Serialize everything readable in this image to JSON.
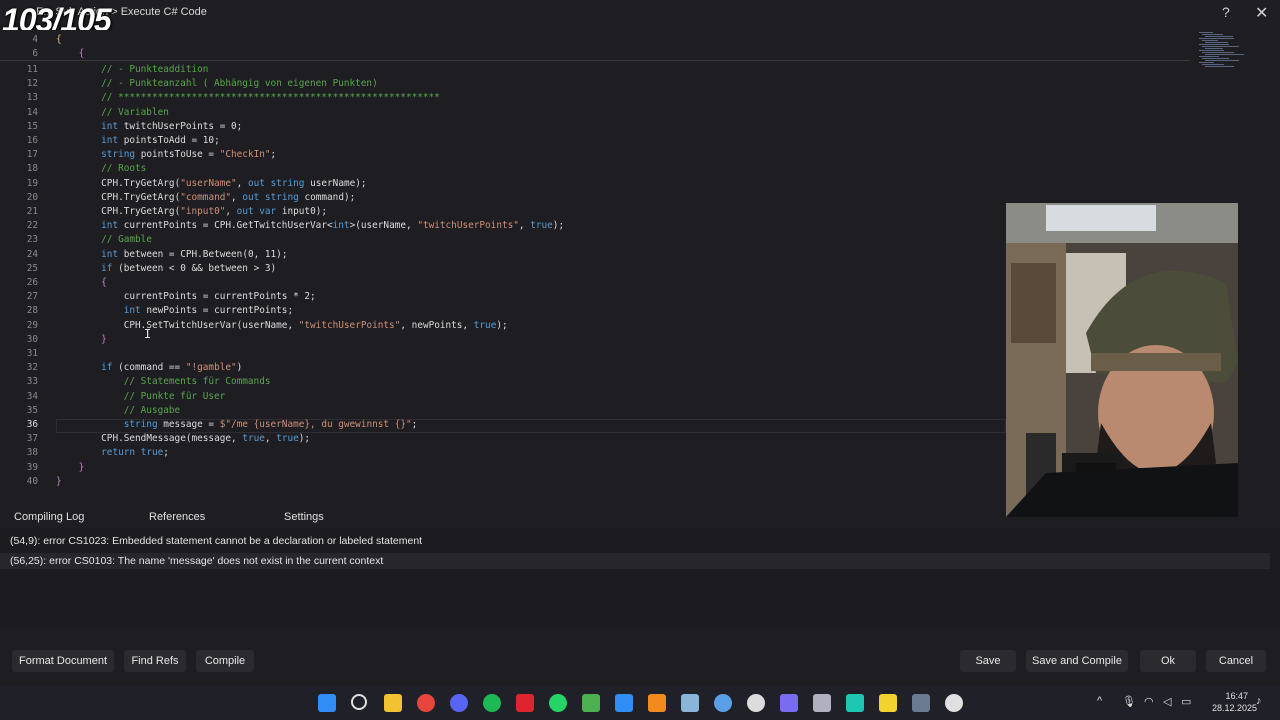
{
  "window": {
    "title": "E... Sub Action > Execute C# Code",
    "overlay_counter": "103/105",
    "help_glyph": "?",
    "close_glyph": "✕"
  },
  "editor": {
    "folded": [
      {
        "num": "4",
        "text": "{"
      },
      {
        "num": "6",
        "text": "    {"
      }
    ],
    "lines": [
      {
        "num": "11",
        "code": "        // - Punkteaddition"
      },
      {
        "num": "12",
        "code": "        // - Punkteanzahl ( Abhängig von eigenen Punkten)"
      },
      {
        "num": "13",
        "code": "        // *********************************************************"
      },
      {
        "num": "14",
        "code": "        // Variablen"
      },
      {
        "num": "15",
        "code": "        int twitchUserPoints = 0;"
      },
      {
        "num": "16",
        "code": "        int pointsToAdd = 10;"
      },
      {
        "num": "17",
        "code": "        string pointsToUse = \"CheckIn\";"
      },
      {
        "num": "18",
        "code": "        // Roots"
      },
      {
        "num": "19",
        "code": "        CPH.TryGetArg(\"userName\", out string userName);"
      },
      {
        "num": "20",
        "code": "        CPH.TryGetArg(\"command\", out string command);"
      },
      {
        "num": "21",
        "code": "        CPH.TryGetArg(\"input0\", out var input0);"
      },
      {
        "num": "22",
        "code": "        int currentPoints = CPH.GetTwitchUserVar<int>(userName, \"twitchUserPoints\", true);"
      },
      {
        "num": "23",
        "code": "        // Gamble"
      },
      {
        "num": "24",
        "code": "        int between = CPH.Between(0, 11);"
      },
      {
        "num": "25",
        "code": "        if (between < 0 && between > 3)"
      },
      {
        "num": "26",
        "code": "        {"
      },
      {
        "num": "27",
        "code": "            currentPoints = currentPoints * 2;"
      },
      {
        "num": "28",
        "code": "            int newPoints = currentPoints;"
      },
      {
        "num": "29",
        "code": "            CPH.SetTwitchUserVar(userName, \"twitchUserPoints\", newPoints, true);"
      },
      {
        "num": "30",
        "code": "        }"
      },
      {
        "num": "31",
        "code": ""
      },
      {
        "num": "32",
        "code": "        if (command == \"!gamble\")"
      },
      {
        "num": "33",
        "code": "            // Statements für Commands"
      },
      {
        "num": "34",
        "code": "            // Punkte für User"
      },
      {
        "num": "35",
        "code": "            // Ausgabe"
      },
      {
        "num": "36",
        "code": "            string message = $\"/me {userName}, du gwewinnst {}\";"
      },
      {
        "num": "37",
        "code": "        CPH.SendMessage(message, true, true);"
      },
      {
        "num": "38",
        "code": "        return true;"
      },
      {
        "num": "39",
        "code": "    }"
      },
      {
        "num": "40",
        "code": "}"
      }
    ],
    "active_line": "36",
    "ibeam_glyph": "I"
  },
  "panel": {
    "tabs": [
      "Compiling Log",
      "References",
      "Settings"
    ],
    "errors": [
      "(54,9): error CS1023: Embedded statement cannot be a declaration or labeled statement",
      "(56,25): error CS0103: The name 'message' does not exist in the current context"
    ]
  },
  "buttons": {
    "format": "Format Document",
    "find_refs": "Find Refs",
    "compile": "Compile",
    "save": "Save",
    "save_compile": "Save and Compile",
    "ok": "Ok",
    "cancel": "Cancel"
  },
  "taskbar": {
    "icons": [
      "windows-start",
      "search",
      "file-explorer",
      "chrome",
      "discord",
      "spotify",
      "red-app",
      "whatsapp",
      "green-editor",
      "vscode",
      "orange-app",
      "steam",
      "blue-globe",
      "obs",
      "streamerbot",
      "audio-app",
      "teal-app",
      "yellow-notes",
      "resolve",
      "chatgpt"
    ],
    "icon_colors": [
      "#2f8df5",
      "#e0e0e0",
      "#f2c230",
      "#e8453c",
      "#5865f2",
      "#1db954",
      "#e0242f",
      "#25d366",
      "#4caf50",
      "#2f8df5",
      "#f28a1e",
      "#8ab4d8",
      "#5aa0e6",
      "#dcdcdc",
      "#7a6cf0",
      "#b0b0c0",
      "#1ec8b0",
      "#f2d22e",
      "#6a7a90",
      "#e0e0e0"
    ],
    "time": "16:47",
    "date": "28.12.2025",
    "chevron": "^"
  }
}
